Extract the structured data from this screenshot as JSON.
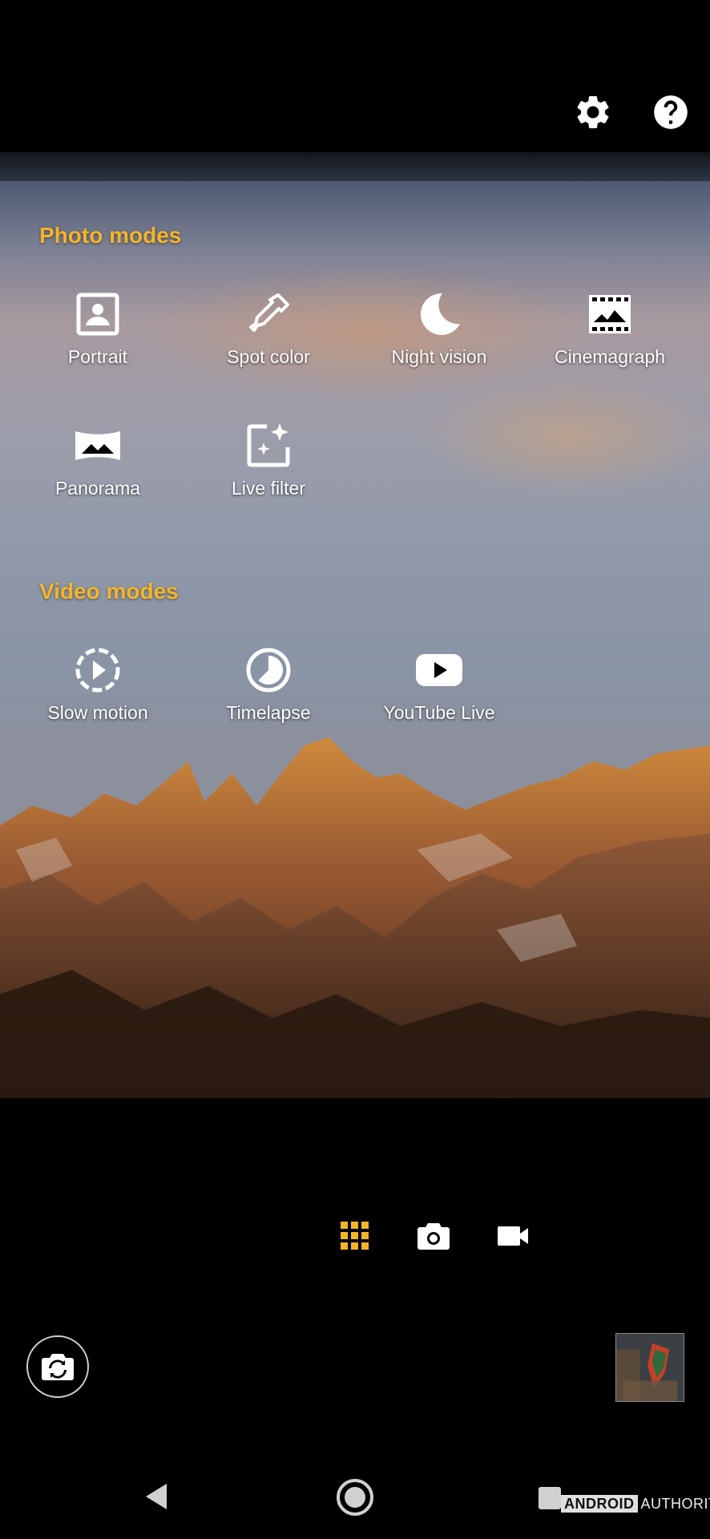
{
  "top_bar": {
    "settings_icon": "gear-icon",
    "help_icon": "help-circle-icon"
  },
  "photo_modes": {
    "title": "Photo modes",
    "items": [
      {
        "label": "Portrait",
        "icon": "portrait-icon"
      },
      {
        "label": "Spot color",
        "icon": "eyedropper-icon"
      },
      {
        "label": "Night vision",
        "icon": "moon-icon"
      },
      {
        "label": "Cinemagraph",
        "icon": "filmstrip-icon"
      },
      {
        "label": "Panorama",
        "icon": "panorama-icon"
      },
      {
        "label": "Live filter",
        "icon": "sparkle-frame-icon"
      }
    ]
  },
  "video_modes": {
    "title": "Video modes",
    "items": [
      {
        "label": "Slow motion",
        "icon": "slow-motion-icon"
      },
      {
        "label": "Timelapse",
        "icon": "timelapse-icon"
      },
      {
        "label": "YouTube Live",
        "icon": "youtube-icon"
      }
    ]
  },
  "mode_switcher": {
    "active": "modes-grid",
    "items": [
      "grid-icon",
      "camera-icon",
      "video-icon"
    ]
  },
  "colors": {
    "accent": "#f5b428",
    "background": "#000000"
  },
  "watermark": {
    "brand_part1": "ANDROID",
    "brand_part2": "AUTHORITY"
  }
}
